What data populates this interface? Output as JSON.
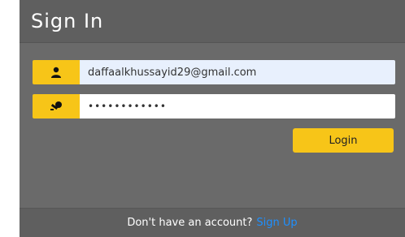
{
  "header": {
    "title": "Sign In"
  },
  "email": {
    "value": "daffaalkhussayid29@gmail.com",
    "icon": "user-icon"
  },
  "password": {
    "value": "••••••••••••",
    "icon": "key-icon"
  },
  "login": {
    "label": "Login"
  },
  "footer": {
    "text": "Don't have an account?",
    "link": "Sign Up"
  },
  "colors": {
    "accent": "#f7c518",
    "link": "#1e90ff",
    "card": "#6a6a6a"
  }
}
